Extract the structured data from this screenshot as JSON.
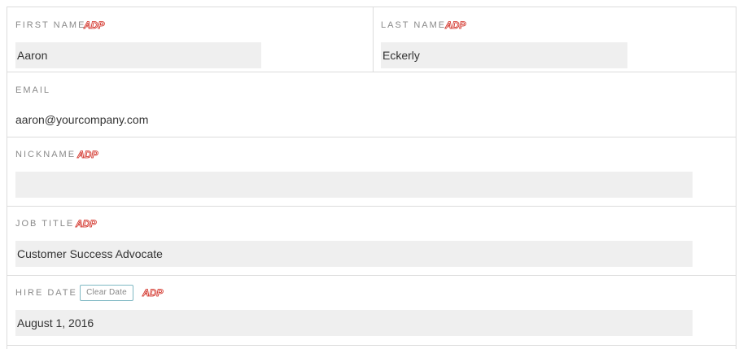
{
  "fields": {
    "first_name": {
      "label": "FIRST NAME",
      "value": "Aaron"
    },
    "last_name": {
      "label": "LAST NAME",
      "value": "Eckerly"
    },
    "email": {
      "label": "EMAIL",
      "value": "aaron@yourcompany.com"
    },
    "nickname": {
      "label": "NICKNAME",
      "value": ""
    },
    "job_title": {
      "label": "JOB TITLE",
      "value": "Customer Success Advocate"
    },
    "hire_date": {
      "label": "HIRE DATE",
      "value": "August 1, 2016",
      "clear_label": "Clear Date"
    }
  },
  "icons": {
    "adp": "adp-logo-icon"
  },
  "colors": {
    "adp_red": "#d0271d",
    "border": "#dcdcdc",
    "field_bg": "#efefef",
    "clear_border": "#7fb8c3"
  }
}
